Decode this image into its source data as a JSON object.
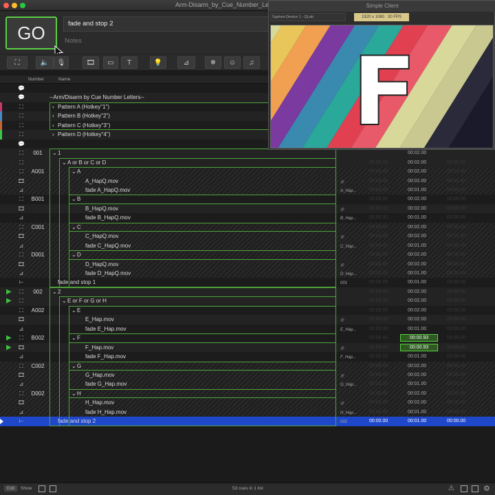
{
  "window": {
    "title": "Arm-Disarm_by_Cue_Number_Letters"
  },
  "go": {
    "label": "GO"
  },
  "cue_name": "fade and stop 2",
  "notes_placeholder": "Notes",
  "toolbar": [
    "⛶",
    "🔈",
    "🎙",
    "🎞",
    "▭",
    "T",
    "💡",
    "⊿",
    "❄",
    "☺",
    "♫"
  ],
  "columns": {
    "number": "Number",
    "name": "Name"
  },
  "rows": [
    {
      "num": "",
      "name": "",
      "icon": "💬",
      "indent": 0,
      "style": "dark"
    },
    {
      "num": "",
      "name": "--Arm/Disarm by Cue Number Letters--",
      "icon": "💬",
      "indent": 72,
      "style": "light"
    },
    {
      "num": "",
      "name": "Pattern A (Hotkey\"1\")",
      "icon": "⛶",
      "indent": 72,
      "disc": "›",
      "style": "dark",
      "bar": "#c83a6a"
    },
    {
      "num": "",
      "name": "Pattern B (Hotkey\"2\")",
      "icon": "⛶",
      "indent": 72,
      "disc": "›",
      "style": "light",
      "bar": "#4a8ac8"
    },
    {
      "num": "",
      "name": "Pattern C (Hotkey\"3\")",
      "icon": "⛶",
      "indent": 72,
      "disc": "›",
      "style": "dark",
      "bar": "#c8643a"
    },
    {
      "num": "",
      "name": "Pattern D (Hotkey\"4\")",
      "icon": "⛶",
      "indent": 72,
      "disc": "›",
      "style": "light",
      "bar": "#3ac84a"
    },
    {
      "num": "",
      "name": "",
      "icon": "💬",
      "indent": 0,
      "style": "dark"
    },
    {
      "num": "001",
      "name": "1",
      "icon": "⛶",
      "indent": 72,
      "disc": "⌄",
      "style": "light",
      "t3": "00:02.00"
    },
    {
      "num": "",
      "name": "A or B or C or D",
      "icon": "⛶",
      "indent": 86,
      "disc": "⌄",
      "style": "light",
      "t2": "00:00.00",
      "t3": "00:02.00",
      "t4": "00:00.00"
    },
    {
      "num": "A001",
      "name": "A",
      "icon": "⛶",
      "indent": 100,
      "disc": "⌄",
      "style": "hatch",
      "t2": "00:00.00",
      "t3": "00:02.00",
      "t4": "00:00.00"
    },
    {
      "num": "",
      "name": "A_HapQ.mov",
      "icon": "🎞",
      "indent": 124,
      "style": "hatch",
      "target": "◎",
      "t2": "00:00.00",
      "t3": "00:02.00",
      "t4": "00:00.00"
    },
    {
      "num": "",
      "name": "fade A_HapQ.mov",
      "icon": "⊿",
      "indent": 124,
      "style": "hatch",
      "target": "A_Hap...",
      "t2": "00:00.00",
      "t3": "00:01.00",
      "t4": "00:00.00"
    },
    {
      "num": "B001",
      "name": "B",
      "icon": "⛶",
      "indent": 100,
      "disc": "⌄",
      "style": "dark",
      "t2": "00:00.00",
      "t3": "00:02.00",
      "t4": "00:00.00"
    },
    {
      "num": "",
      "name": "B_HapQ.mov",
      "icon": "🎞",
      "indent": 124,
      "style": "light",
      "target": "◎",
      "t2": "00:00.00",
      "t3": "00:02.00",
      "t4": "00:00.00"
    },
    {
      "num": "",
      "name": "fade B_HapQ.mov",
      "icon": "⊿",
      "indent": 124,
      "style": "dark",
      "target": "B_Hap...",
      "t2": "00:00.00",
      "t3": "00:01.00",
      "t4": "00:00.00"
    },
    {
      "num": "C001",
      "name": "C",
      "icon": "⛶",
      "indent": 100,
      "disc": "⌄",
      "style": "hatch",
      "t2": "00:00.00",
      "t3": "00:02.00",
      "t4": "00:00.00"
    },
    {
      "num": "",
      "name": "C_HapQ.mov",
      "icon": "🎞",
      "indent": 124,
      "style": "hatch",
      "target": "◎",
      "t2": "00:00.00",
      "t3": "00:02.00",
      "t4": "00:00.00"
    },
    {
      "num": "",
      "name": "fade C_HapQ.mov",
      "icon": "⊿",
      "indent": 124,
      "style": "hatch",
      "target": "C_Hap...",
      "t2": "00:00.00",
      "t3": "00:01.00",
      "t4": "00:00.00"
    },
    {
      "num": "D001",
      "name": "D",
      "icon": "⛶",
      "indent": 100,
      "disc": "⌄",
      "style": "hatch",
      "t2": "00:00.00",
      "t3": "00:02.00",
      "t4": "00:00.00"
    },
    {
      "num": "",
      "name": "D_HapQ.mov",
      "icon": "🎞",
      "indent": 124,
      "style": "hatch",
      "target": "◎",
      "t2": "00:00.00",
      "t3": "00:02.00",
      "t4": "00:00.00"
    },
    {
      "num": "",
      "name": "fade D_HapQ.mov",
      "icon": "⊿",
      "indent": 124,
      "style": "hatch",
      "target": "D_Hap...",
      "t2": "00:00.00",
      "t3": "00:01.00",
      "t4": "00:00.00"
    },
    {
      "num": "",
      "name": "fade and stop 1",
      "icon": "⊢",
      "indent": 84,
      "style": "dark",
      "target": "001",
      "t2": "00:00.00",
      "t3": "00:01.00",
      "t4": "00:00.00"
    },
    {
      "num": "002",
      "name": "2",
      "icon": "⛶",
      "indent": 72,
      "disc": "⌄",
      "style": "light",
      "play": true,
      "t2": "00:00.00",
      "t3": "00:02.00",
      "t4": "00:00.00"
    },
    {
      "num": "",
      "name": "E or F or G or H",
      "icon": "⛶",
      "indent": 86,
      "disc": "⌄",
      "style": "light",
      "play": true,
      "t2": "00:00.00",
      "t3": "00:02.00",
      "t4": "00:00.00"
    },
    {
      "num": "A002",
      "name": "E",
      "icon": "⛶",
      "indent": 100,
      "disc": "⌄",
      "style": "dark",
      "t2": "00:00.00",
      "t3": "00:02.00",
      "t4": "00:00.00"
    },
    {
      "num": "",
      "name": "E_Hap.mov",
      "icon": "🎞",
      "indent": 124,
      "style": "light",
      "target": "◎",
      "t2": "00:00.00",
      "t3": "00:02.00",
      "t4": "00:00.00"
    },
    {
      "num": "",
      "name": "fade E_Hap.mov",
      "icon": "⊿",
      "indent": 124,
      "style": "dark",
      "target": "E_Hap...",
      "t2": "00:00.00",
      "t3": "00:01.00",
      "t4": "00:00.00"
    },
    {
      "num": "B002",
      "name": "F",
      "icon": "⛶",
      "indent": 100,
      "disc": "⌄",
      "style": "dark",
      "play": true,
      "t2": "00:00.00",
      "t3": "00:00.93",
      "t4": "00:00.00",
      "active": true
    },
    {
      "num": "",
      "name": "F_Hap.mov",
      "icon": "🎞",
      "indent": 124,
      "style": "light",
      "play": true,
      "target": "◎",
      "t2": "00:00.00",
      "t3": "00:00.93",
      "t4": "00:00.00",
      "active": true
    },
    {
      "num": "",
      "name": "fade F_Hap.mov",
      "icon": "⊿",
      "indent": 124,
      "style": "dark",
      "target": "F_Hap...",
      "t2": "00:00.00",
      "t3": "00:01.00",
      "t4": "00:00.00"
    },
    {
      "num": "C002",
      "name": "G",
      "icon": "⛶",
      "indent": 100,
      "disc": "⌄",
      "style": "hatch",
      "t2": "00:00.00",
      "t3": "00:02.00",
      "t4": "00:00.00"
    },
    {
      "num": "",
      "name": "G_Hap.mov",
      "icon": "🎞",
      "indent": 124,
      "style": "hatch",
      "target": "◎",
      "t2": "00:00.00",
      "t3": "00:02.00",
      "t4": "00:00.00"
    },
    {
      "num": "",
      "name": "fade G_Hap.mov",
      "icon": "⊿",
      "indent": 124,
      "style": "hatch",
      "target": "G_Hap...",
      "t2": "00:00.00",
      "t3": "00:01.00",
      "t4": "00:00.00"
    },
    {
      "num": "D002",
      "name": "H",
      "icon": "⛶",
      "indent": 100,
      "disc": "⌄",
      "style": "hatch",
      "t2": "00:00.00",
      "t3": "00:02.00",
      "t4": "00:00.00"
    },
    {
      "num": "",
      "name": "H_Hap.mov",
      "icon": "🎞",
      "indent": 124,
      "style": "hatch",
      "target": "◎",
      "t2": "00:00.00",
      "t3": "00:02.00",
      "t4": "00:00.00"
    },
    {
      "num": "",
      "name": "fade H_Hap.mov",
      "icon": "⊿",
      "indent": 124,
      "style": "hatch",
      "target": "H_Hap...",
      "t2": "00:00.00",
      "t3": "00:01.00",
      "t4": "00:00.00"
    },
    {
      "num": "",
      "name": "fade and stop 2",
      "icon": "⊢",
      "indent": 84,
      "style": "sel",
      "target": "002",
      "t2": "00:00.00",
      "t3": "00:01.00",
      "t4": "00:00.00"
    }
  ],
  "footer": {
    "edit": "Edit",
    "show": "Show",
    "status": "53 cues in 1 list"
  },
  "simple_client": {
    "title": "Simple Client",
    "device": "Syphon Device 1 - QLab",
    "resolution": "1920 x 1080 : 30 FPS",
    "letter": "F"
  },
  "colors": {
    "accent_green": "#5ad145",
    "selection_blue": "#1f47c9"
  }
}
